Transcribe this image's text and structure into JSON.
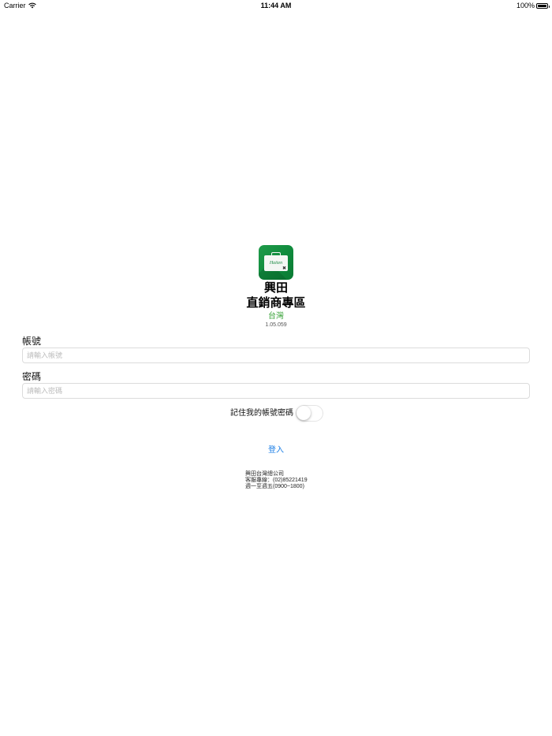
{
  "status_bar": {
    "carrier": "Carrier",
    "time": "11:44 AM",
    "battery": "100%"
  },
  "app": {
    "logo_text": "Haiten",
    "brand_line1": "興田",
    "brand_line2": "直銷商專區",
    "region": "台灣",
    "version": "1.05.059"
  },
  "form": {
    "account_label": "帳號",
    "account_placeholder": "請輸入帳號",
    "account_value": "",
    "password_label": "密碼",
    "password_placeholder": "請輸入密碼",
    "password_value": "",
    "remember_label": "記住我的帳號密碼",
    "remember_on": false,
    "login_label": "登入"
  },
  "footer": {
    "company": "興田台灣總公司",
    "hotline": "客服專線：(02)85221419",
    "hours": "週一至週五(0900~1800)"
  },
  "colors": {
    "brand_green": "#0f8a3c",
    "region_green": "#3aa33a",
    "link_blue": "#1a7ee6"
  }
}
